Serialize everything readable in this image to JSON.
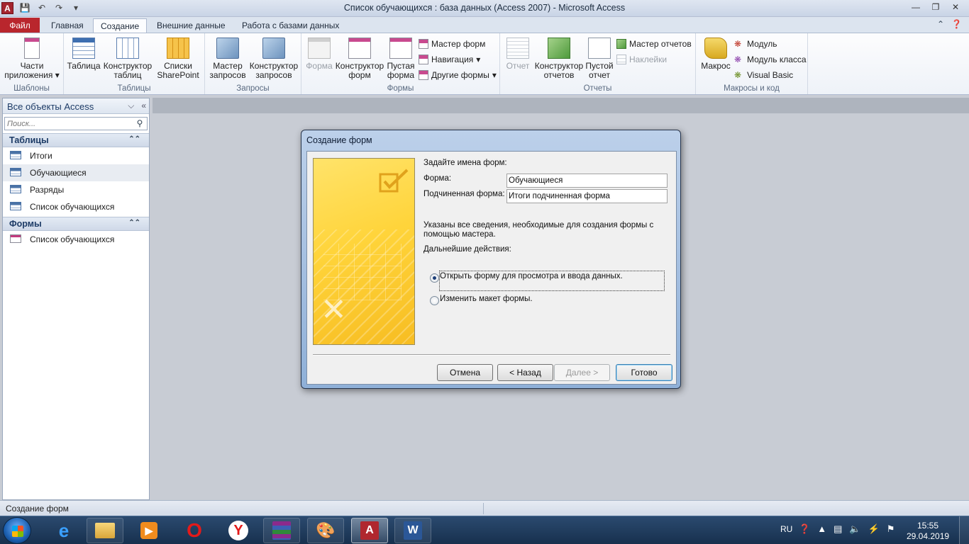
{
  "window": {
    "title": "Список обучающихся : база данных (Access 2007)  -  Microsoft Access",
    "app_icon_letter": "A"
  },
  "ribbon_tabs": {
    "file": "Файл",
    "home": "Главная",
    "create": "Создание",
    "external": "Внешние данные",
    "dbtools": "Работа с базами данных",
    "active": "Создание"
  },
  "ribbon": {
    "templates": {
      "label": "Шаблоны",
      "app_parts": "Части приложения"
    },
    "tables": {
      "label": "Таблицы",
      "table": "Таблица",
      "table_design": "Конструктор таблиц",
      "sharepoint": "Списки SharePoint"
    },
    "queries": {
      "label": "Запросы",
      "wizard": "Мастер запросов",
      "design": "Конструктор запросов"
    },
    "forms": {
      "label": "Формы",
      "form": "Форма",
      "form_design": "Конструктор форм",
      "blank_form": "Пустая форма",
      "form_wizard": "Мастер форм",
      "navigation": "Навигация",
      "more_forms": "Другие формы"
    },
    "reports": {
      "label": "Отчеты",
      "report": "Отчет",
      "report_design": "Конструктор отчетов",
      "blank_report": "Пустой отчет",
      "report_wizard": "Мастер отчетов",
      "labels": "Наклейки"
    },
    "macros": {
      "label": "Макросы и код",
      "macro": "Макрос",
      "module": "Модуль",
      "class_module": "Модуль класса",
      "vb": "Visual Basic"
    }
  },
  "navpane": {
    "header": "Все объекты Access",
    "search_placeholder": "Поиск...",
    "tables_section": "Таблицы",
    "tables": [
      "Итоги",
      "Обучающиеся",
      "Разряды",
      "Список обучающихся"
    ],
    "forms_section": "Формы",
    "forms": [
      "Список обучающихся"
    ]
  },
  "dialog": {
    "title": "Создание форм",
    "prompt": "Задайте имена форм:",
    "form_label": "Форма:",
    "form_value": "Обучающиеся",
    "subform_label": "Подчиненная форма:",
    "subform_value": "Итоги подчиненная форма",
    "info": "Указаны все сведения, необходимые для создания формы с помощью мастера.",
    "next_actions": "Дальнейшие действия:",
    "option_open": "Открыть форму для просмотра и ввода данных.",
    "option_modify": "Изменить макет формы.",
    "selected_option": "open",
    "btn_cancel": "Отмена",
    "btn_back": "< Назад",
    "btn_next": "Далее >",
    "btn_finish": "Готово"
  },
  "statusbar": {
    "text": "Создание форм"
  },
  "taskbar": {
    "lang": "RU",
    "time": "15:55",
    "date": "29.04.2019",
    "apps": [
      "internet-explorer",
      "file-explorer",
      "video-player",
      "opera",
      "yandex-browser",
      "winrar",
      "paint",
      "access",
      "word"
    ],
    "active_app": "access"
  }
}
